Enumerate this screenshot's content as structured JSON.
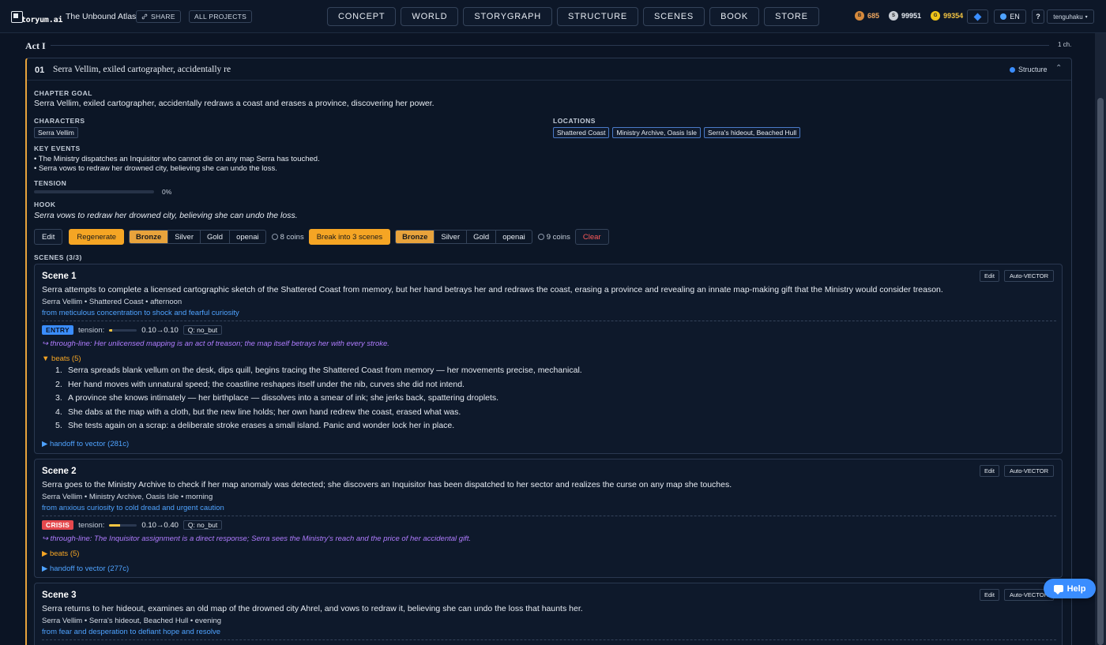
{
  "app": {
    "logo_text": "Storyum.ai",
    "project_title": "The Unbound Atlas",
    "share_label": "SHARE",
    "all_projects_label": "ALL PROJECTS",
    "nav_tabs": [
      "CONCEPT",
      "WORLD",
      "STORYGRAPH",
      "STRUCTURE",
      "SCENES",
      "BOOK",
      "STORE"
    ],
    "coins": {
      "bronze": "685",
      "silver": "99951",
      "gold": "99354"
    },
    "coin_letters": {
      "bronze": "B",
      "silver": "S",
      "gold": "G"
    },
    "lang": "EN",
    "help_q": "?",
    "user": "tenguhaku",
    "help_float": "Help"
  },
  "act": {
    "title": "Act I",
    "count": "1 ch."
  },
  "chapter": {
    "num": "01",
    "title": "Serra Vellim, exiled cartographer, accidentally re",
    "structure_label": "Structure",
    "goal_label": "CHAPTER GOAL",
    "goal": "Serra Vellim, exiled cartographer, accidentally redraws a coast and erases a province, discovering her power.",
    "characters_label": "CHARACTERS",
    "characters": [
      "Serra Vellim"
    ],
    "locations_label": "LOCATIONS",
    "locations": [
      "Shattered Coast",
      "Ministry Archive, Oasis Isle",
      "Serra's hideout, Beached Hull"
    ],
    "key_events_label": "KEY EVENTS",
    "key_events": [
      "• The Ministry dispatches an Inquisitor who cannot die on any map Serra has touched.",
      "• Serra vows to redraw her drowned city, believing she can undo the loss."
    ],
    "tension_label": "TENSION",
    "tension_pct": "0%",
    "tension_value": 0,
    "hook_label": "HOOK",
    "hook": "Serra vows to redraw her drowned city, believing she can undo the loss.",
    "actions": {
      "edit": "Edit",
      "regenerate": "Regenerate",
      "tiers": [
        "Bronze",
        "Silver",
        "Gold",
        "openai"
      ],
      "regen_cost": "8 coins",
      "break": "Break into 3 scenes",
      "break_cost": "9 coins",
      "clear": "Clear"
    },
    "scenes_label": "SCENES (3/3)"
  },
  "scenes": [
    {
      "title": "Scene 1",
      "edit": "Edit",
      "auto": "Auto-VECTOR",
      "summary": "Serra attempts to complete a licensed cartographic sketch of the Shattered Coast from memory, but her hand betrays her and redraws the coast, erasing a province and revealing an innate map-making gift that the Ministry would consider treason.",
      "meta": "Serra Vellim • Shattered Coast • afternoon",
      "arc": "from meticulous concentration to shock and fearful curiosity",
      "badge": "ENTRY",
      "tension_label": "tension:",
      "tension": "0.10→0.10",
      "tension_fill": 0.1,
      "q": "Q: no_but",
      "through": "↪ through-line: Her unlicensed mapping is an act of treason; the map itself betrays her with every stroke.",
      "beats_toggle": "▼ beats (5)",
      "beats": [
        "Serra spreads blank vellum on the desk, dips quill, begins tracing the Shattered Coast from memory — her movements precise, mechanical.",
        "Her hand moves with unnatural speed; the coastline reshapes itself under the nib, curves she did not intend.",
        "A province she knows intimately — her birthplace — dissolves into a smear of ink; she jerks back, spattering droplets.",
        "She dabs at the map with a cloth, but the new line holds; her own hand redrew the coast, erased what was.",
        "She tests again on a scrap: a deliberate stroke erases a small island. Panic and wonder lock her in place."
      ],
      "handoff": "▶ handoff to vector (281c)"
    },
    {
      "title": "Scene 2",
      "edit": "Edit",
      "auto": "Auto-VECTOR",
      "summary": "Serra goes to the Ministry Archive to check if her map anomaly was detected; she discovers an Inquisitor has been dispatched to her sector and realizes the curse on any map she touches.",
      "meta": "Serra Vellim • Ministry Archive, Oasis Isle • morning",
      "arc": "from anxious curiosity to cold dread and urgent caution",
      "badge": "CRISIS",
      "tension_label": "tension:",
      "tension": "0.10→0.40",
      "tension_fill": 0.4,
      "q": "Q: no_but",
      "through": "↪ through-line: The Inquisitor assignment is a direct response; Serra sees the Ministry's reach and the price of her accidental gift.",
      "beats_toggle": "▶ beats (5)",
      "handoff": "▶ handoff to vector (277c)"
    },
    {
      "title": "Scene 3",
      "edit": "Edit",
      "auto": "Auto-VECTOR",
      "summary": "Serra returns to her hideout, examines an old map of the drowned city Ahrel, and vows to redraw it, believing she can undo the loss that haunts her.",
      "meta": "Serra Vellim • Serra's hideout, Beached Hull • evening",
      "arc": "from fear and desperation to defiant hope and resolve"
    }
  ],
  "colors": {
    "accent": "#f5a524",
    "blue": "#3a8dff",
    "purple": "#b07cff",
    "bg": "#0b1424"
  }
}
